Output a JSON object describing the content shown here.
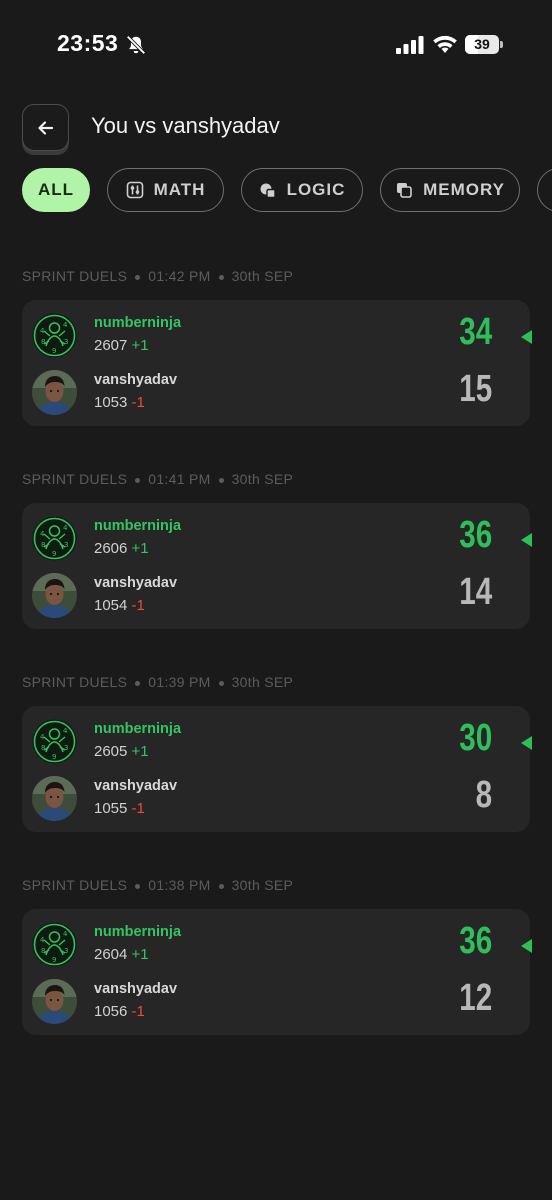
{
  "status_bar": {
    "time": "23:53",
    "battery": "39"
  },
  "header": {
    "title": "You vs vanshyadav"
  },
  "tabs": [
    {
      "label": "ALL",
      "active": true
    },
    {
      "label": "MATH"
    },
    {
      "label": "LOGIC"
    },
    {
      "label": "MEMORY"
    },
    {
      "label": ""
    }
  ],
  "duels": [
    {
      "meta": {
        "type": "SPRINT DUELS",
        "time": "01:42 PM",
        "date": "30th SEP"
      },
      "p1": {
        "name": "numberninja",
        "rating": "2607",
        "delta": "+1",
        "score": "34"
      },
      "p2": {
        "name": "vanshyadav",
        "rating": "1053",
        "delta": "-1",
        "score": "15"
      }
    },
    {
      "meta": {
        "type": "SPRINT DUELS",
        "time": "01:41 PM",
        "date": "30th SEP"
      },
      "p1": {
        "name": "numberninja",
        "rating": "2606",
        "delta": "+1",
        "score": "36"
      },
      "p2": {
        "name": "vanshyadav",
        "rating": "1054",
        "delta": "-1",
        "score": "14"
      }
    },
    {
      "meta": {
        "type": "SPRINT DUELS",
        "time": "01:39 PM",
        "date": "30th SEP"
      },
      "p1": {
        "name": "numberninja",
        "rating": "2605",
        "delta": "+1",
        "score": "30"
      },
      "p2": {
        "name": "vanshyadav",
        "rating": "1055",
        "delta": "-1",
        "score": "8"
      }
    },
    {
      "meta": {
        "type": "SPRINT DUELS",
        "time": "01:38 PM",
        "date": "30th SEP"
      },
      "p1": {
        "name": "numberninja",
        "rating": "2604",
        "delta": "+1",
        "score": "36"
      },
      "p2": {
        "name": "vanshyadav",
        "rating": "1056",
        "delta": "-1",
        "score": "12"
      }
    }
  ],
  "colors": {
    "accent": "#35c463",
    "active_tab": "#b0f5a7",
    "loss": "#ef4a3a",
    "card": "#262626",
    "background": "#1a1a1a"
  },
  "icons": {
    "back": "arrow-left-icon",
    "math": "sliders-icon",
    "logic": "shapes-icon",
    "memory": "cards-icon",
    "winner": "winner-arrow-icon"
  }
}
